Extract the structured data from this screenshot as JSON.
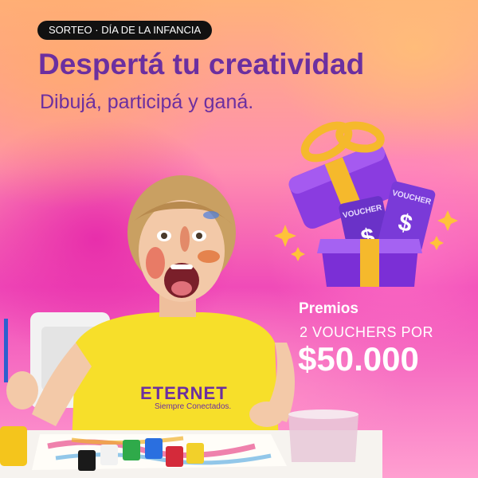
{
  "badge": "SORTEO · DÍA DE LA INFANCIA",
  "headline": "Despertá tu creatividad",
  "subheadline": "Dibujá, participá y ganá.",
  "prize": {
    "label": "Premios",
    "line": "2 VOUCHERS POR",
    "amount": "$50.000"
  },
  "voucher_label": "VOUCHER",
  "voucher_symbol": "$",
  "brand": {
    "name": "ETERNET",
    "tagline": "Siempre Conectados."
  },
  "colors": {
    "purple": "#6b2fa0",
    "badge_bg": "#111111",
    "shirt": "#f7df2a"
  }
}
